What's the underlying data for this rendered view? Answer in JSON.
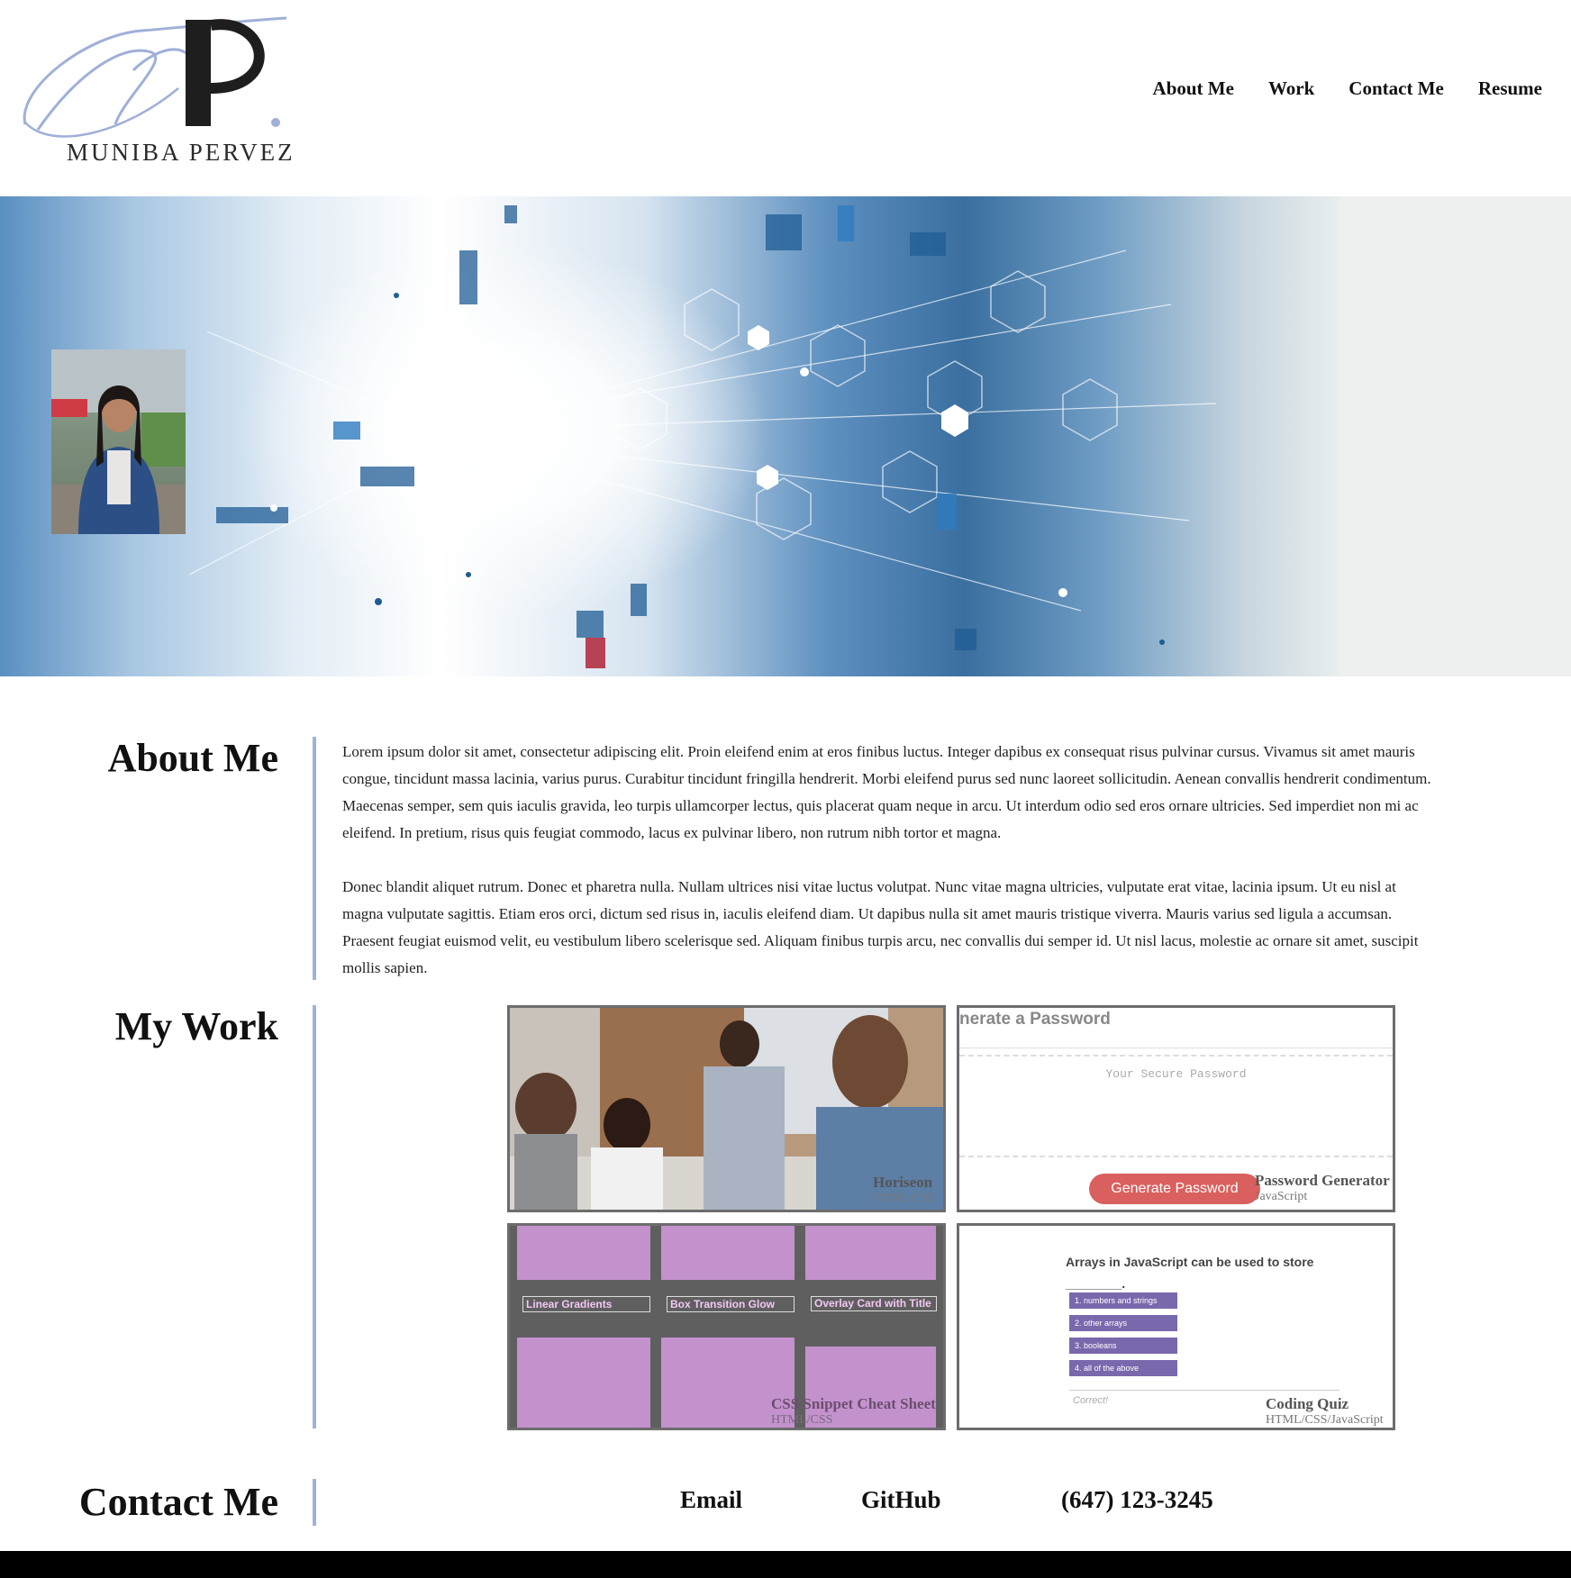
{
  "brand": {
    "name": "MUNIBA PERVEZ",
    "monogram": "MP"
  },
  "nav": [
    {
      "label": "About Me"
    },
    {
      "label": "Work"
    },
    {
      "label": "Contact Me"
    },
    {
      "label": "Resume"
    }
  ],
  "about": {
    "heading": "About Me",
    "paragraphs": [
      "Lorem ipsum dolor sit amet, consectetur adipiscing elit. Proin eleifend enim at eros finibus luctus. Integer dapibus ex consequat risus pulvinar cursus. Vivamus sit amet mauris congue, tincidunt massa lacinia, varius purus. Curabitur tincidunt fringilla hendrerit. Morbi eleifend purus sed nunc laoreet sollicitudin. Aenean convallis hendrerit condimentum. Maecenas semper, sem quis iaculis gravida, leo turpis ullamcorper lectus, quis placerat quam neque in arcu. Ut interdum odio sed eros ornare ultricies. Sed imperdiet non mi ac eleifend. In pretium, risus quis feugiat commodo, lacus ex pulvinar libero, non rutrum nibh tortor et magna.",
      "Donec blandit aliquet rutrum. Donec et pharetra nulla. Nullam ultrices nisi vitae luctus volutpat. Nunc vitae magna ultricies, vulputate erat vitae, lacinia ipsum. Ut eu nisl at magna vulputate sagittis. Etiam eros orci, dictum sed risus in, iaculis eleifend diam. Ut dapibus nulla sit amet mauris tristique viverra. Mauris varius sed ligula a accumsan. Praesent feugiat euismod velit, eu vestibulum libero scelerisque sed. Aliquam finibus turpis arcu, nec convallis dui semper id. Ut nisl lacus, molestie ac ornare sit amet, suscipit mollis sapien."
    ]
  },
  "work": {
    "heading": "My Work",
    "projects": [
      {
        "title": "Horiseon",
        "tech": "HTML/CSS"
      },
      {
        "title": "Password Generator",
        "tech": "JavaScript",
        "preview": {
          "heading": "nerate a Password",
          "placeholder": "Your Secure Password",
          "button": "Generate Password"
        }
      },
      {
        "title": "CSS Snippet Cheat Sheet",
        "tech": "HTML/CSS",
        "preview": {
          "cards": [
            "Linear Gradients",
            "Box Transition Glow",
            "Overlay Card with Title"
          ]
        }
      },
      {
        "title": "Coding Quiz",
        "tech": "HTML/CSS/JavaScript",
        "preview": {
          "question": "Arrays in JavaScript can be used to store ________.",
          "options": [
            "1. numbers and strings",
            "2. other arrays",
            "3. booleans",
            "4. all of the above"
          ],
          "feedback": "Correct!"
        }
      }
    ]
  },
  "contact": {
    "heading": "Contact Me",
    "email": "Email",
    "github": "GitHub",
    "phone": "(647) 123-3245"
  },
  "colors": {
    "accent_line": "#9fb3d9",
    "card_border": "#6d6d6d",
    "button_red": "#d9605e",
    "quiz_purple": "#7a68ad",
    "footer": "#000000"
  }
}
